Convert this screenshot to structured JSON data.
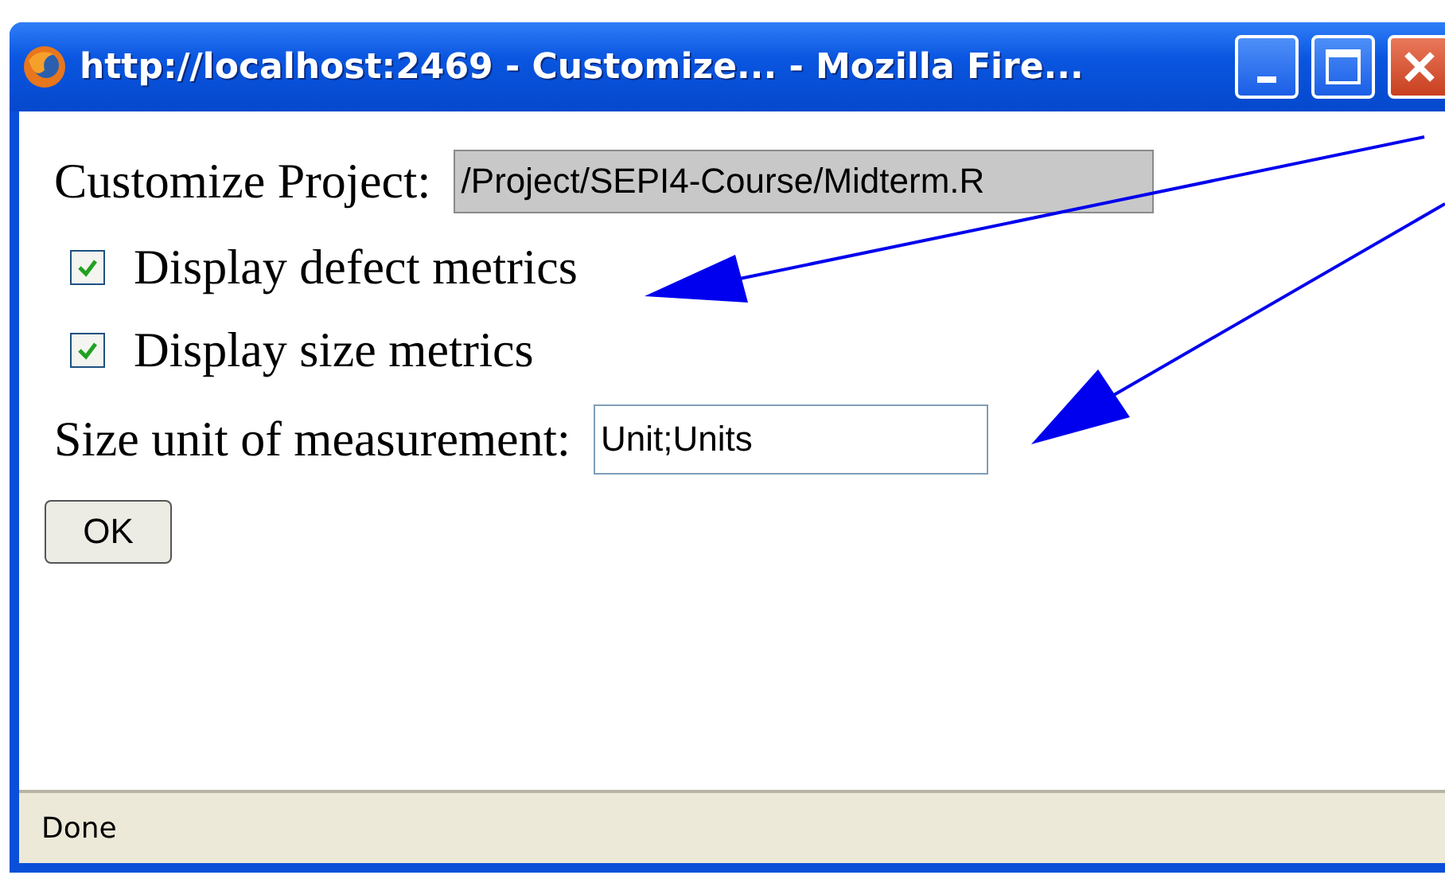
{
  "window": {
    "title": "http://localhost:2469 - Customize... - Mozilla Fire..."
  },
  "form": {
    "project": {
      "label": "Customize Project:",
      "value": "/Project/SEPI4-Course/Midterm.R",
      "disabled": true
    },
    "options": [
      {
        "label": "Display defect metrics",
        "checked": true
      },
      {
        "label": "Display size metrics",
        "checked": true
      }
    ],
    "size_unit": {
      "label": "Size unit of measurement:",
      "value": "Unit;Units"
    },
    "button": "OK"
  },
  "status_bar": {
    "text": "Done"
  }
}
